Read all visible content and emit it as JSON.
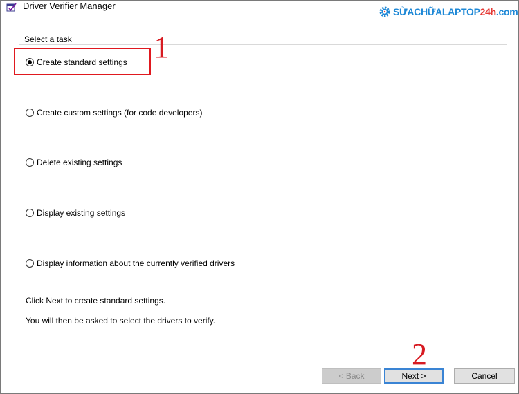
{
  "window": {
    "title": "Driver Verifier Manager",
    "icon": "driver-verifier-icon"
  },
  "watermark": {
    "part1": "SỬACHỮALAPTOP",
    "part2": "24h",
    "part3": ".com",
    "icon": "gear-icon"
  },
  "task_group": {
    "label": "Select a task",
    "options": [
      {
        "label": "Create standard settings",
        "selected": true
      },
      {
        "label": "Create custom settings (for code developers)",
        "selected": false
      },
      {
        "label": "Delete existing settings",
        "selected": false
      },
      {
        "label": "Display existing settings",
        "selected": false
      },
      {
        "label": "Display information about the currently verified drivers",
        "selected": false
      }
    ]
  },
  "info": {
    "line1": "Click Next to create standard settings.",
    "line2": "You will then be asked to select the drivers to verify."
  },
  "buttons": {
    "back": "< Back",
    "next": "Next >",
    "cancel": "Cancel"
  },
  "annotations": {
    "step1": "1",
    "step2": "2"
  },
  "colors": {
    "annotation_red": "#d71b22",
    "focus_blue": "#3a84d4",
    "brand_blue": "#1e88d6",
    "brand_red": "#e53935"
  }
}
